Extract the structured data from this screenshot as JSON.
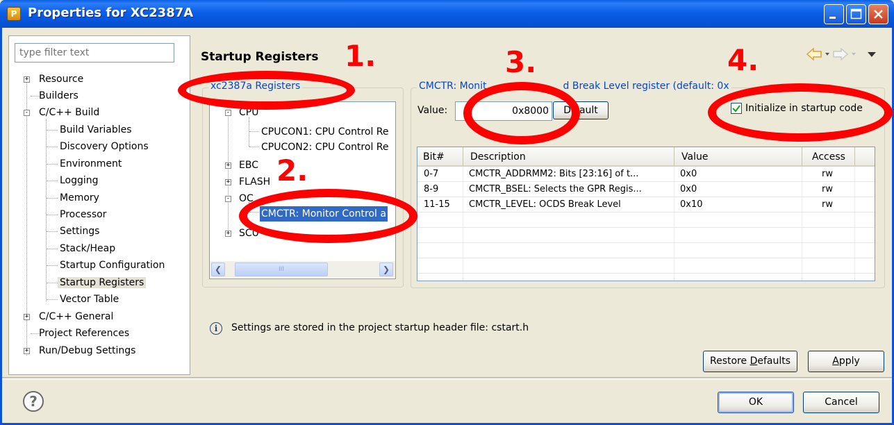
{
  "window": {
    "title": "Properties for XC2387A",
    "app_icon": "P",
    "controls": [
      "minimize-icon",
      "maximize-icon",
      "close-icon"
    ]
  },
  "sidebar": {
    "filter_placeholder": "type filter text",
    "items": [
      {
        "label": "Resource",
        "expander": "+"
      },
      {
        "label": "Builders"
      },
      {
        "label": "C/C++ Build",
        "expander": "-"
      },
      {
        "label": "Build Variables"
      },
      {
        "label": "Discovery Options"
      },
      {
        "label": "Environment"
      },
      {
        "label": "Logging"
      },
      {
        "label": "Memory"
      },
      {
        "label": "Processor"
      },
      {
        "label": "Settings"
      },
      {
        "label": "Stack/Heap"
      },
      {
        "label": "Startup Configuration"
      },
      {
        "label": "Startup Registers",
        "selected": true
      },
      {
        "label": "Vector Table"
      },
      {
        "label": "C/C++ General",
        "expander": "+"
      },
      {
        "label": "Project References"
      },
      {
        "label": "Run/Debug Settings",
        "expander": "+"
      }
    ]
  },
  "page": {
    "title": "Startup Registers"
  },
  "registers": {
    "group_label": "xc2387a Registers",
    "tree": [
      {
        "label": "CPU",
        "expander": "-"
      },
      {
        "label": "CPUCON1: CPU Control Re"
      },
      {
        "label": "CPUCON2: CPU Control Re"
      },
      {
        "label": "EBC",
        "expander": "+"
      },
      {
        "label": "FLASH",
        "expander": "+"
      },
      {
        "label": "OC",
        "expander": "-"
      },
      {
        "label": "CMCTR: Monitor Control a",
        "selected": true
      },
      {
        "label": "SCU",
        "expander": "+"
      }
    ],
    "scroll_thumb": "III"
  },
  "detail": {
    "group_label_part1": "CMCTR: Monit",
    "group_label_part2": "d Break Level register (default: 0x",
    "value_label": "Value:",
    "value": "0x8000",
    "default_button_part1": "D",
    "default_button_part2": "ault",
    "init_label": "Initialize in startup code",
    "init_checked": true,
    "table": {
      "headers": [
        "Bit#",
        "Description",
        "Value",
        "Access"
      ],
      "rows": [
        [
          "0-7",
          "CMCTR_ADDRMM2: Bits [23:16] of t...",
          "0x0",
          "rw"
        ],
        [
          "8-9",
          "CMCTR_BSEL: Selects the GPR Regis...",
          "0x0",
          "rw"
        ],
        [
          "11-15",
          "CMCTR_LEVEL: OCDS Break Level",
          "0x10",
          "rw"
        ]
      ]
    }
  },
  "info": {
    "icon": "i",
    "text": "Settings are stored in the project startup header file: cstart.h"
  },
  "buttons": {
    "restore_defaults_pre": "Restore ",
    "restore_defaults_u": "D",
    "restore_defaults_post": "efaults",
    "apply_u": "A",
    "apply_post": "pply",
    "ok": "OK",
    "cancel": "Cancel"
  },
  "help_icon": "?",
  "annotations": [
    "1.",
    "2.",
    "3.",
    "4."
  ],
  "colors": {
    "title_bar": "#0a5fe4",
    "group_label": "#0046d5",
    "selection": "#316ac5",
    "annotation": "#ff0000",
    "nav_arrow": "#f0a030"
  }
}
